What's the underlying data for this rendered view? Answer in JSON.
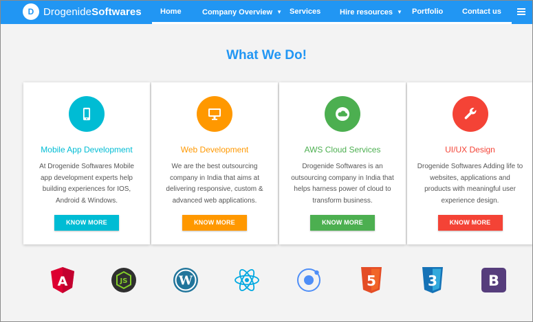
{
  "brand": {
    "initial": "D",
    "name_regular": "Drogenide",
    "name_bold": "Softwares"
  },
  "nav": {
    "items": [
      {
        "label": "Home"
      },
      {
        "label": "Company Overview"
      },
      {
        "label": "Services"
      },
      {
        "label": "Hire resources"
      },
      {
        "label": "Portfolio"
      },
      {
        "label": "Contact us"
      }
    ]
  },
  "section": {
    "title": "What We Do!"
  },
  "cards": [
    {
      "title": "Mobile App Development",
      "desc": "At Drogenide Softwares Mobile app development experts help building experiences for IOS, Android & Windows.",
      "button": "KNOW MORE",
      "color": "#00bcd4",
      "icon": "mobile-phone-icon"
    },
    {
      "title": "Web Development",
      "desc": "We are the best outsourcing company in India that aims at delivering responsive, custom & advanced web applications.",
      "button": "KNOW MORE",
      "color": "#ff9800",
      "icon": "desktop-monitor-icon"
    },
    {
      "title": "AWS Cloud Services",
      "desc": "Drogenide Softwares is an outsourcing company in India that helps harness power of cloud to transform business.",
      "button": "KNOW MORE",
      "color": "#4caf50",
      "icon": "cloud-icon"
    },
    {
      "title": "UI/UX Design",
      "desc": "Drogenide Softwares Adding life to websites, applications and products with meaningful user experience design.",
      "button": "KNOW MORE",
      "color": "#f44336",
      "icon": "wrench-icon"
    }
  ],
  "tech": [
    {
      "icon": "angular-logo-icon",
      "label": "A"
    },
    {
      "icon": "nodejs-logo-icon",
      "label": "JS"
    },
    {
      "icon": "wordpress-logo-icon",
      "label": "W"
    },
    {
      "icon": "react-logo-icon"
    },
    {
      "icon": "ionic-logo-icon"
    },
    {
      "icon": "html5-logo-icon",
      "label": "5"
    },
    {
      "icon": "css3-logo-icon",
      "label": "3"
    },
    {
      "icon": "bootstrap-logo-icon",
      "label": "B"
    }
  ],
  "colors": {
    "primary": "#2196f3",
    "background": "#f3f3f3"
  }
}
